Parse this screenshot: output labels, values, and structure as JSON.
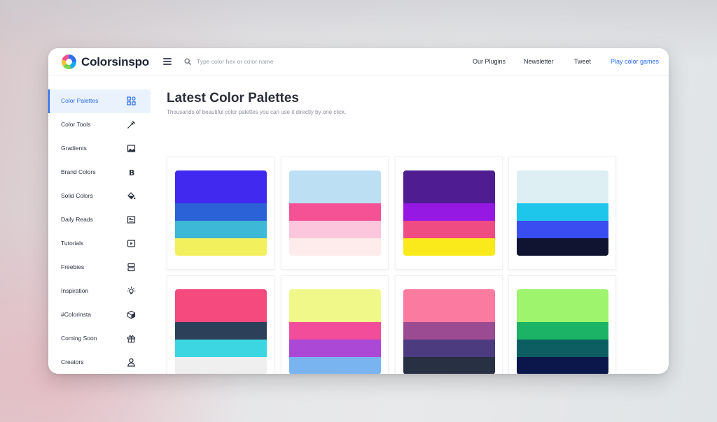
{
  "brand": {
    "name": "Colorsinspo"
  },
  "search": {
    "placeholder": "Type color hex or color name"
  },
  "nav": [
    {
      "label": "Our Plugins"
    },
    {
      "label": "Newsletter"
    },
    {
      "label": "Tweet"
    },
    {
      "label": "Play color games"
    }
  ],
  "sidebar": {
    "items": [
      {
        "label": "Color Palettes",
        "icon": "grid-icon",
        "active": true
      },
      {
        "label": "Color Tools",
        "icon": "eyedropper-icon"
      },
      {
        "label": "Gradients",
        "icon": "image-icon"
      },
      {
        "label": "Brand Colors",
        "icon": "bold-b-icon"
      },
      {
        "label": "Solid Colors",
        "icon": "paint-bucket-icon"
      },
      {
        "label": "Daily Reads",
        "icon": "newspaper-icon"
      },
      {
        "label": "Tutorials",
        "icon": "play-icon"
      },
      {
        "label": "Freebies",
        "icon": "stack-icon"
      },
      {
        "label": "Inspiration",
        "icon": "bulb-icon"
      },
      {
        "label": "#Colorinsta",
        "icon": "cube-icon"
      },
      {
        "label": "Coming Soon",
        "icon": "gift-icon"
      },
      {
        "label": "Creators",
        "icon": "user-icon"
      }
    ]
  },
  "main": {
    "title": "Latest Color Palettes",
    "subtitle": "Thousands of beautiful color palettes you can use it directly by one click."
  },
  "palettes": [
    [
      "#4229f0",
      "#2c62d8",
      "#3db8d6",
      "#f3f05d"
    ],
    [
      "#bcdff4",
      "#f45295",
      "#fcc6dd",
      "#fdeceb"
    ],
    [
      "#4f1c92",
      "#9519e3",
      "#f04c84",
      "#faea1c"
    ],
    [
      "#ddeff3",
      "#1dc6ea",
      "#3a4df0",
      "#101431"
    ],
    [
      "#f54a7d",
      "#2c4059",
      "#3bd6e2",
      "#efeff0"
    ],
    [
      "#f1f88a",
      "#f24d9a",
      "#ab48d6",
      "#79b4f0"
    ],
    [
      "#fb7aa0",
      "#9b4b92",
      "#4d3b80",
      "#283044"
    ],
    [
      "#9ef46d",
      "#1cb366",
      "#0c5e62",
      "#0b174b"
    ]
  ],
  "colors": {
    "accent": "#2a6cf0",
    "text": "#2b3140",
    "muted": "#8b909a"
  }
}
